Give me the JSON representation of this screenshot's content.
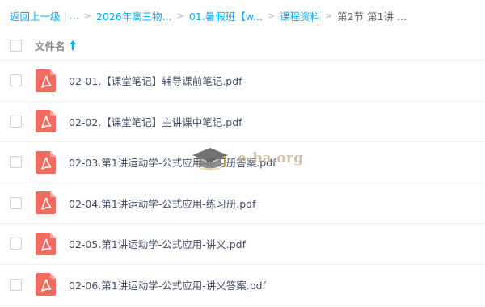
{
  "breadcrumb": {
    "back": "返回上一级",
    "ellipsis": "...",
    "items": [
      "2026年高三物...",
      "01.暑假班【w...",
      "课程资料"
    ],
    "current": "第2节 第1讲 ..."
  },
  "list_header": {
    "column_label": "文件名",
    "sort_direction": "ascending"
  },
  "files": [
    {
      "name": "02-01.【课堂笔记】辅导课前笔记.pdf",
      "icon": "pdf-icon"
    },
    {
      "name": "02-02.【课堂笔记】主讲课中笔记.pdf",
      "icon": "pdf-icon"
    },
    {
      "name": "02-03.第1讲运动学-公式应用-练习册答案.pdf",
      "icon": "pdf-icon"
    },
    {
      "name": "02-04.第1讲运动学-公式应用-练习册.pdf",
      "icon": "pdf-icon"
    },
    {
      "name": "02-05.第1讲运动学-公式应用-讲义.pdf",
      "icon": "pdf-icon"
    },
    {
      "name": "02-06.第1讲运动学-公式应用-讲义答案.pdf",
      "icon": "pdf-icon"
    }
  ],
  "watermark": {
    "text": "e-ba.org",
    "icon": "graduation-cap-icon"
  },
  "colors": {
    "link": "#09aaff",
    "pdf_red": "#f26b5f",
    "file_text": "#424e67"
  }
}
